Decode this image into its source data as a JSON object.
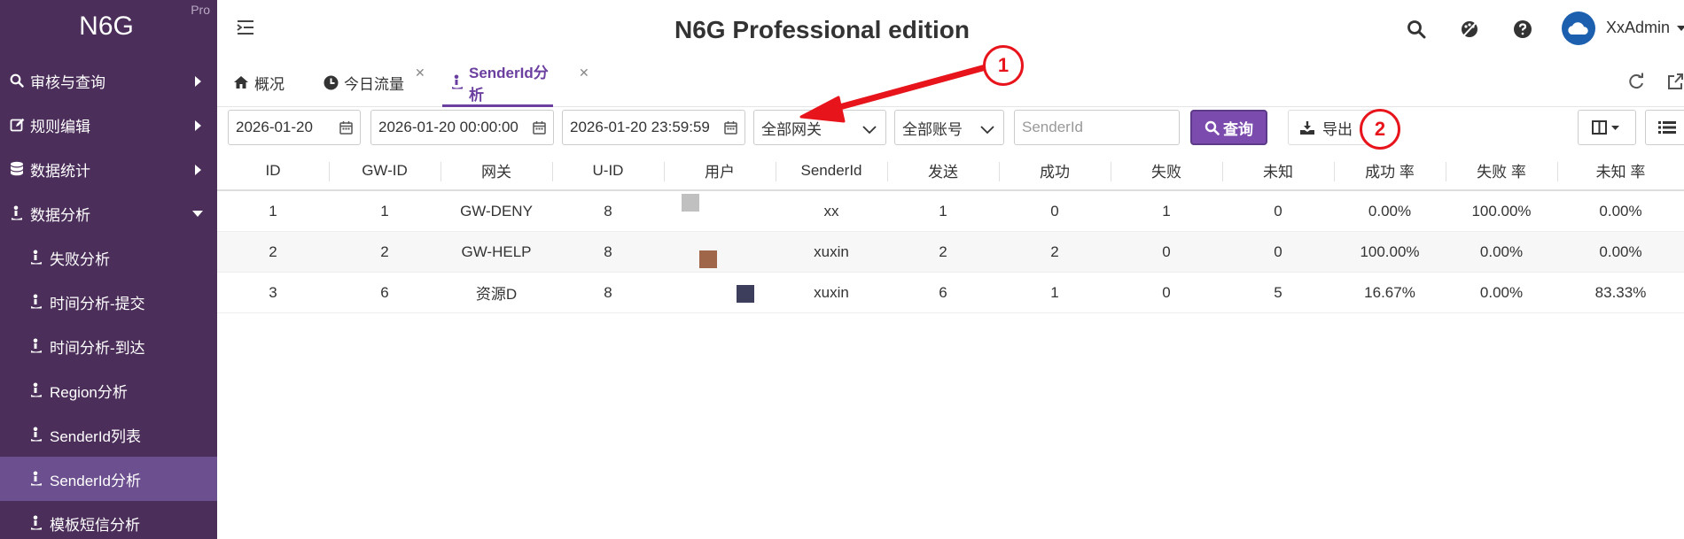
{
  "sidebar": {
    "logo": "N6G",
    "edition_badge": "Pro",
    "groups": [
      {
        "label": "审核与查询",
        "icon": "search-icon"
      },
      {
        "label": "规则编辑",
        "icon": "edit-icon"
      },
      {
        "label": "数据统计",
        "icon": "database-icon"
      },
      {
        "label": "数据分析",
        "icon": "analysis-icon",
        "expanded": true
      }
    ],
    "items": [
      {
        "label": "失败分析"
      },
      {
        "label": "时间分析-提交"
      },
      {
        "label": "时间分析-到达"
      },
      {
        "label": "Region分析"
      },
      {
        "label": "SenderId列表"
      },
      {
        "label": "SenderId分析",
        "active": true
      },
      {
        "label": "模板短信分析"
      }
    ],
    "bg_color": "#4b2e5a",
    "active_color": "#6b4f8e"
  },
  "header": {
    "title": "N6G Professional edition",
    "username": "XxAdmin"
  },
  "tabs": [
    {
      "label": "概况",
      "icon": "home-icon"
    },
    {
      "label": "今日流量",
      "icon": "clock-icon",
      "closable": true
    },
    {
      "label": "SenderId分析",
      "icon": "analysis-icon",
      "closable": true,
      "active": true
    }
  ],
  "toolbar": {
    "date": "2026-01-20",
    "start_time": "2026-01-20 00:00:00",
    "end_time": "2026-01-20 23:59:59",
    "gateway_select": "全部网关",
    "account_select": "全部账号",
    "senderid_placeholder": "SenderId",
    "query_label": "查询",
    "export_label": "导出"
  },
  "annotations": {
    "marker_1": "1",
    "marker_2": "2",
    "color": "#e8141c"
  },
  "table": {
    "columns": [
      "ID",
      "GW-ID",
      "网关",
      "U-ID",
      "用户",
      "SenderId",
      "发送",
      "成功",
      "失败",
      "未知",
      "成功 率",
      "失败 率",
      "未知 率"
    ],
    "rows": [
      {
        "id": "1",
        "gw_id": "1",
        "gateway": "GW-DENY",
        "uid": "8",
        "user_color": "#c0c0c0",
        "senderid": "xx",
        "sent": "1",
        "success": "0",
        "fail": "1",
        "unknown": "0",
        "success_rate": "0.00%",
        "fail_rate": "100.00%",
        "unknown_rate": "0.00%"
      },
      {
        "id": "2",
        "gw_id": "2",
        "gateway": "GW-HELP",
        "uid": "8",
        "user_color": "#a0664a",
        "senderid": "xuxin",
        "sent": "2",
        "success": "2",
        "fail": "0",
        "unknown": "0",
        "success_rate": "100.00%",
        "fail_rate": "0.00%",
        "unknown_rate": "0.00%"
      },
      {
        "id": "3",
        "gw_id": "6",
        "gateway": "资源D",
        "uid": "8",
        "user_color": "#3d3d5c",
        "senderid": "xuxin",
        "sent": "6",
        "success": "1",
        "fail": "0",
        "unknown": "5",
        "success_rate": "16.67%",
        "fail_rate": "0.00%",
        "unknown_rate": "83.33%"
      }
    ]
  }
}
